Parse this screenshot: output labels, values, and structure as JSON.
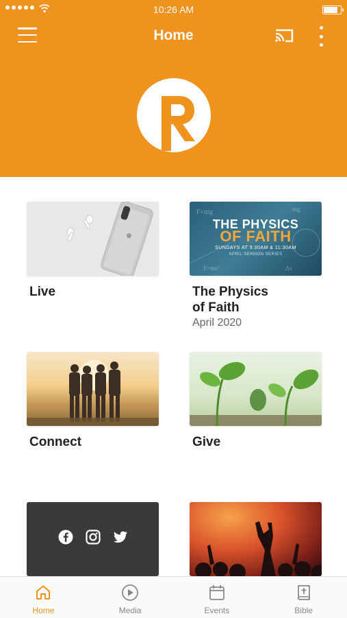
{
  "status_bar": {
    "time": "10:26 AM",
    "battery_level": 0.9
  },
  "header": {
    "title": "Home",
    "logo_letter": "R"
  },
  "colors": {
    "accent": "#F0931E",
    "text": "#222222",
    "muted": "#666666"
  },
  "cards": [
    {
      "label": "Live",
      "subtitle": "",
      "thumb": "phone-earbuds-photo"
    },
    {
      "label": "The Physics\nof Faith",
      "subtitle": "April 2020",
      "thumb": "physics-of-faith-artwork",
      "art": {
        "line1": "THE PHYSICS",
        "line2": "OF FAITH",
        "line3": "SUNDAYS AT 9:30AM & 11:30AM",
        "line4": "APRIL SERMON SERIES"
      }
    },
    {
      "label": "Connect",
      "subtitle": "",
      "thumb": "friends-sunset-photo"
    },
    {
      "label": "Give",
      "subtitle": "",
      "thumb": "seedlings-photo"
    },
    {
      "label": "",
      "subtitle": "",
      "thumb": "social-links",
      "icons": [
        "facebook-icon",
        "instagram-icon",
        "twitter-icon"
      ]
    },
    {
      "label": "",
      "subtitle": "",
      "thumb": "worship-concert-photo"
    }
  ],
  "tabs": [
    {
      "label": "Home",
      "icon": "home-icon",
      "active": true
    },
    {
      "label": "Media",
      "icon": "play-circle-icon",
      "active": false
    },
    {
      "label": "Events",
      "icon": "calendar-icon",
      "active": false
    },
    {
      "label": "Bible",
      "icon": "bible-icon",
      "active": false
    }
  ]
}
